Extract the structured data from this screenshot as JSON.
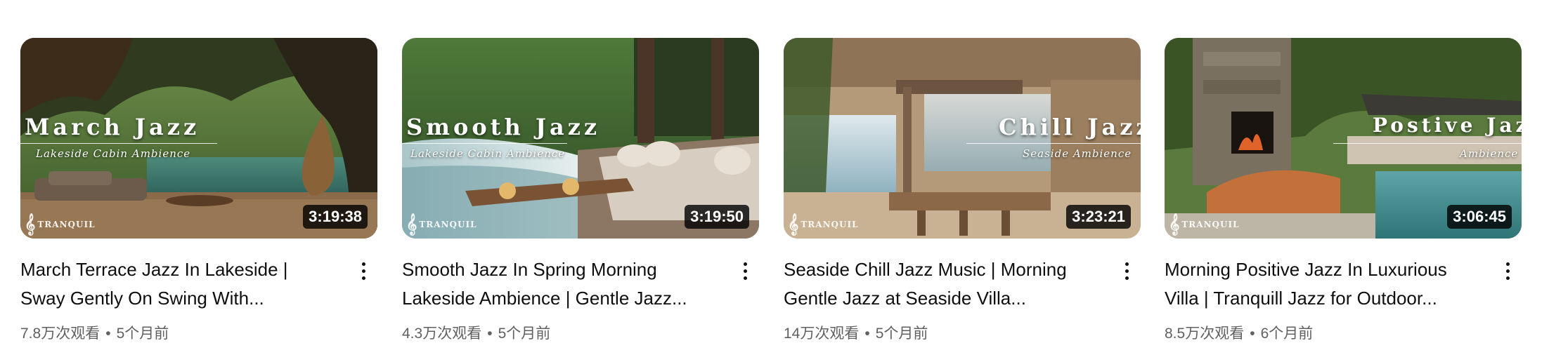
{
  "videos": [
    {
      "title_line1": "March Terrace Jazz In Lakeside |",
      "title_line2": "Sway Gently On Swing With...",
      "duration": "3:19:38",
      "views": "7.8万次观看",
      "age": "5个月前",
      "overlay_title": "March Jazz",
      "overlay_subtitle": "Lakeside Cabin Ambience",
      "logo": "TRANQUIL"
    },
    {
      "title_line1": "Smooth Jazz In Spring Morning",
      "title_line2": "Lakeside Ambience | Gentle Jazz...",
      "duration": "3:19:50",
      "views": "4.3万次观看",
      "age": "5个月前",
      "overlay_title": "Smooth Jazz",
      "overlay_subtitle": "Lakeside Cabin Ambience",
      "logo": "TRANQUIL"
    },
    {
      "title_line1": "Seaside Chill Jazz Music | Morning",
      "title_line2": "Gentle Jazz at Seaside Villa...",
      "duration": "3:23:21",
      "views": "14万次观看",
      "age": "5个月前",
      "overlay_title": "Chill Jazz",
      "overlay_subtitle": "Seaside Ambience",
      "logo": "TRANQUIL"
    },
    {
      "title_line1": "Morning Positive Jazz In Luxurious",
      "title_line2": "Villa | Tranquill Jazz for Outdoor...",
      "duration": "3:06:45",
      "views": "8.5万次观看",
      "age": "6个月前",
      "overlay_title": "Postive Jazz",
      "overlay_subtitle": "Ambience",
      "logo": "TRANQUIL"
    }
  ],
  "separator": "•",
  "icons": {
    "menu": "more-vertical-icon",
    "logo_glyph": "treble-clef-icon"
  }
}
